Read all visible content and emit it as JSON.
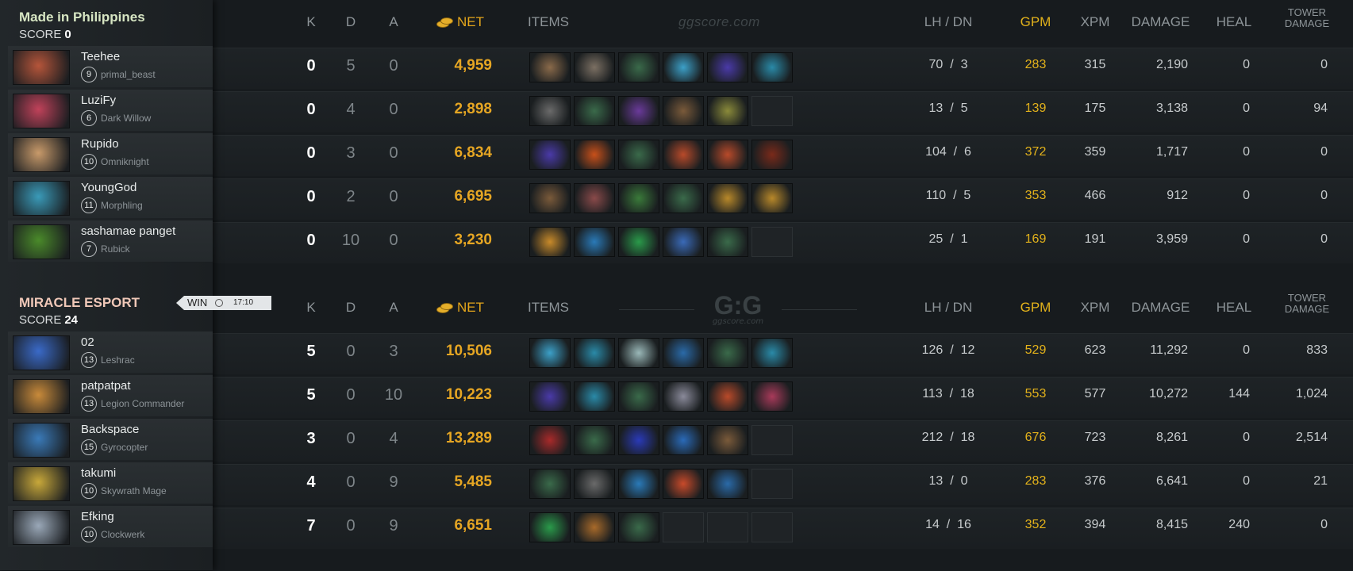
{
  "columns": {
    "k": "K",
    "d": "D",
    "a": "A",
    "net": "NET",
    "items": "ITEMS",
    "lh_dn": "LH  /  DN",
    "gpm": "GPM",
    "xpm": "XPM",
    "damage": "DAMAGE",
    "heal": "HEAL",
    "tower_line1": "TOWER",
    "tower_line2": "DAMAGE"
  },
  "watermark": "ggscore.com",
  "watermark_logo": "G:G",
  "watermark_logo_sub": "ggscore.com",
  "result": {
    "label": "WIN",
    "time": "17:10"
  },
  "teams": [
    {
      "name": "Made in Philippines",
      "name_color": "#d7e6c3",
      "score_label": "SCORE",
      "score": "0",
      "players": [
        {
          "name": "Teehee",
          "level": "9",
          "hero": "primal_beast",
          "portrait": "#b5553a",
          "k": "0",
          "d": "5",
          "a": "0",
          "net": "4,959",
          "lh": "70",
          "dn": "3",
          "gpm": "283",
          "xpm": "315",
          "damage": "2,190",
          "heal": "0",
          "tower": "0",
          "items": [
            {
              "icon": "axe-item-icon",
              "color": "#8a6a4a"
            },
            {
              "icon": "chainmail-item-icon",
              "color": "#7c7063"
            },
            {
              "icon": "blade-item-icon",
              "color": "#3a6a4a"
            },
            {
              "icon": "bottle-item-icon",
              "color": "#3ca0c8"
            },
            {
              "icon": "hood-item-icon",
              "color": "#4a3aa8"
            },
            {
              "icon": "wind-lace-item-icon",
              "color": "#2a8aa8"
            }
          ]
        },
        {
          "name": "LuziFy",
          "level": "6",
          "hero": "Dark Willow",
          "portrait": "#c0425a",
          "k": "0",
          "d": "4",
          "a": "0",
          "net": "2,898",
          "lh": "13",
          "dn": "5",
          "gpm": "139",
          "xpm": "175",
          "damage": "3,138",
          "heal": "0",
          "tower": "94",
          "items": [
            {
              "icon": "sickle-item-icon",
              "color": "#6a6a6a"
            },
            {
              "icon": "blade-item-icon",
              "color": "#3a6a4a"
            },
            {
              "icon": "orb-item-icon",
              "color": "#6a3a9a"
            },
            {
              "icon": "boots-item-icon",
              "color": "#7a5a3a"
            },
            {
              "icon": "mask-item-icon",
              "color": "#8a8a3a"
            },
            {
              "icon": "empty-slot",
              "color": ""
            }
          ]
        },
        {
          "name": "Rupido",
          "level": "10",
          "hero": "Omniknight",
          "portrait": "#c89a6a",
          "k": "0",
          "d": "3",
          "a": "0",
          "net": "6,834",
          "lh": "104",
          "dn": "6",
          "gpm": "372",
          "xpm": "359",
          "damage": "1,717",
          "heal": "0",
          "tower": "0",
          "items": [
            {
              "icon": "hood-item-icon",
              "color": "#4a3aa8"
            },
            {
              "icon": "phoenix-item-icon",
              "color": "#c8501a"
            },
            {
              "icon": "blade-item-icon",
              "color": "#3a6a4a"
            },
            {
              "icon": "ring-item-icon",
              "color": "#b84a2a"
            },
            {
              "icon": "ring-item-icon",
              "color": "#b84a2a"
            },
            {
              "icon": "cloak-item-icon",
              "color": "#7a2a1a"
            }
          ]
        },
        {
          "name": "YoungGod",
          "level": "11",
          "hero": "Morphling",
          "portrait": "#3a9ab8",
          "k": "0",
          "d": "2",
          "a": "0",
          "net": "6,695",
          "lh": "110",
          "dn": "5",
          "gpm": "353",
          "xpm": "466",
          "damage": "912",
          "heal": "0",
          "tower": "0",
          "items": [
            {
              "icon": "boots-item-icon",
              "color": "#7a5a3a"
            },
            {
              "icon": "helm-item-icon",
              "color": "#8a4a4a"
            },
            {
              "icon": "sword-item-icon",
              "color": "#3a7a3a"
            },
            {
              "icon": "blade-item-icon",
              "color": "#3a6a4a"
            },
            {
              "icon": "claw-item-icon",
              "color": "#b8882a"
            },
            {
              "icon": "claw-item-icon",
              "color": "#b8882a"
            }
          ]
        },
        {
          "name": "sashamae panget",
          "level": "7",
          "hero": "Rubick",
          "portrait": "#4a8a2a",
          "k": "0",
          "d": "10",
          "a": "0",
          "net": "3,230",
          "lh": "25",
          "dn": "1",
          "gpm": "169",
          "xpm": "191",
          "damage": "3,959",
          "heal": "0",
          "tower": "0",
          "items": [
            {
              "icon": "mango-item-icon",
              "color": "#c88a2a"
            },
            {
              "icon": "wards-item-icon",
              "color": "#2a7ab8"
            },
            {
              "icon": "slippers-item-icon",
              "color": "#2a9a4a"
            },
            {
              "icon": "potion-item-icon",
              "color": "#3a6ab8"
            },
            {
              "icon": "blade-item-icon",
              "color": "#3a6a4a"
            },
            {
              "icon": "empty-slot",
              "color": ""
            }
          ]
        }
      ]
    },
    {
      "name": "MIRACLE ESPORT",
      "name_color": "#f0c8b8",
      "score_label": "SCORE",
      "score": "24",
      "players": [
        {
          "name": "02",
          "level": "13",
          "hero": "Leshrac",
          "portrait": "#3a6ac8",
          "k": "5",
          "d": "0",
          "a": "3",
          "net": "10,506",
          "lh": "126",
          "dn": "12",
          "gpm": "529",
          "xpm": "623",
          "damage": "11,292",
          "heal": "0",
          "tower": "833",
          "items": [
            {
              "icon": "bottle-item-icon",
              "color": "#3ca0c8"
            },
            {
              "icon": "wind-lace-item-icon",
              "color": "#2a8aa8"
            },
            {
              "icon": "eul-item-icon",
              "color": "#9ab8b8"
            },
            {
              "icon": "scroll-item-icon",
              "color": "#2a6aa8"
            },
            {
              "icon": "blade-item-icon",
              "color": "#3a6a4a"
            },
            {
              "icon": "wind-lace-item-icon",
              "color": "#2a8aa8"
            }
          ]
        },
        {
          "name": "patpatpat",
          "level": "13",
          "hero": "Legion Commander",
          "portrait": "#c88a3a",
          "k": "5",
          "d": "0",
          "a": "10",
          "net": "10,223",
          "lh": "113",
          "dn": "18",
          "gpm": "553",
          "xpm": "577",
          "damage": "10,272",
          "heal": "144",
          "tower": "1,024",
          "items": [
            {
              "icon": "hood-item-icon",
              "color": "#4a3aa8"
            },
            {
              "icon": "wind-lace-item-icon",
              "color": "#2a8aa8"
            },
            {
              "icon": "blade-item-icon",
              "color": "#3a6a4a"
            },
            {
              "icon": "blink-item-icon",
              "color": "#8a8a9a"
            },
            {
              "icon": "ring-item-icon",
              "color": "#b84a2a"
            },
            {
              "icon": "octopus-item-icon",
              "color": "#a83a5a"
            }
          ]
        },
        {
          "name": "Backspace",
          "level": "15",
          "hero": "Gyrocopter",
          "portrait": "#3a7ab8",
          "k": "3",
          "d": "0",
          "a": "4",
          "net": "13,289",
          "lh": "212",
          "dn": "18",
          "gpm": "676",
          "xpm": "723",
          "damage": "8,261",
          "heal": "0",
          "tower": "2,514",
          "items": [
            {
              "icon": "armor-item-icon",
              "color": "#a82a2a"
            },
            {
              "icon": "blade-item-icon",
              "color": "#3a6a4a"
            },
            {
              "icon": "spear-item-icon",
              "color": "#2a3ab8"
            },
            {
              "icon": "dagger-item-icon",
              "color": "#2a6ab8"
            },
            {
              "icon": "boots-item-icon",
              "color": "#7a5a3a"
            },
            {
              "icon": "empty-slot",
              "color": ""
            }
          ]
        },
        {
          "name": "takumi",
          "level": "10",
          "hero": "Skywrath Mage",
          "portrait": "#c8a83a",
          "k": "4",
          "d": "0",
          "a": "9",
          "net": "5,485",
          "lh": "13",
          "dn": "0",
          "gpm": "283",
          "xpm": "376",
          "damage": "6,641",
          "heal": "0",
          "tower": "21",
          "items": [
            {
              "icon": "blade-item-icon",
              "color": "#3a6a4a"
            },
            {
              "icon": "sickle-item-icon",
              "color": "#6a6a6a"
            },
            {
              "icon": "wards-item-icon",
              "color": "#2a7ab8"
            },
            {
              "icon": "shield-item-icon",
              "color": "#c84a2a"
            },
            {
              "icon": "scroll-item-icon",
              "color": "#2a6aa8"
            },
            {
              "icon": "empty-slot",
              "color": ""
            }
          ]
        },
        {
          "name": "Efking",
          "level": "10",
          "hero": "Clockwerk",
          "portrait": "#9aa8b8",
          "k": "7",
          "d": "0",
          "a": "9",
          "net": "6,651",
          "lh": "14",
          "dn": "16",
          "gpm": "352",
          "xpm": "394",
          "damage": "8,415",
          "heal": "240",
          "tower": "0",
          "items": [
            {
              "icon": "slippers-item-icon",
              "color": "#2a9a4a"
            },
            {
              "icon": "crown-item-icon",
              "color": "#a86a2a"
            },
            {
              "icon": "blade-item-icon",
              "color": "#3a6a4a"
            },
            {
              "icon": "empty-slot",
              "color": ""
            },
            {
              "icon": "empty-slot",
              "color": ""
            },
            {
              "icon": "empty-slot",
              "color": ""
            }
          ]
        }
      ]
    }
  ]
}
